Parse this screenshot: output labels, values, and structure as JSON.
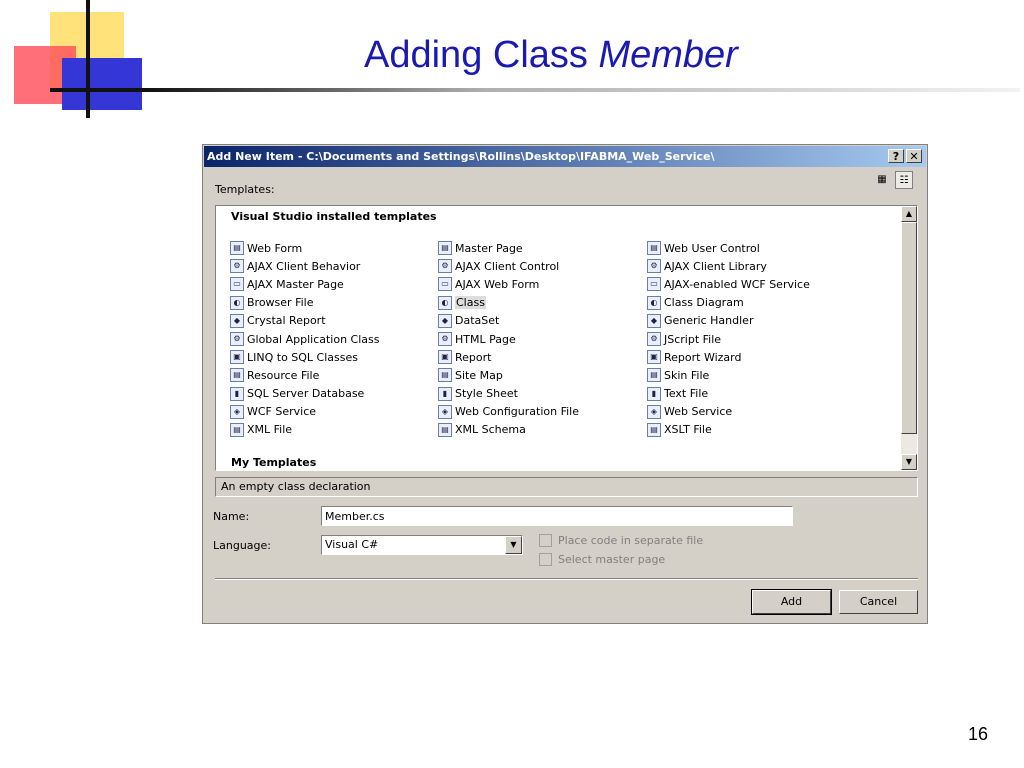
{
  "slide": {
    "title_plain": "Adding Class ",
    "title_emph": "Member",
    "page_number": "16"
  },
  "dialog": {
    "title": "Add New Item - C:\\Documents and Settings\\Rollins\\Desktop\\IFABMA_Web_Service\\",
    "help_label": "?",
    "close_label": "✕",
    "templates_label": "Templates:",
    "group_installed": "Visual Studio installed templates",
    "group_my": "My Templates",
    "columns": [
      [
        {
          "label": "Web Form",
          "icon": "web-form-icon"
        },
        {
          "label": "AJAX Client Behavior",
          "icon": "ajax-client-behavior-icon"
        },
        {
          "label": "AJAX Master Page",
          "icon": "ajax-master-page-icon"
        },
        {
          "label": "Browser File",
          "icon": "browser-file-icon"
        },
        {
          "label": "Crystal Report",
          "icon": "crystal-report-icon"
        },
        {
          "label": "Global Application Class",
          "icon": "global-application-class-icon"
        },
        {
          "label": "LINQ to SQL Classes",
          "icon": "linq-to-sql-icon"
        },
        {
          "label": "Resource File",
          "icon": "resource-file-icon"
        },
        {
          "label": "SQL Server Database",
          "icon": "sql-database-icon"
        },
        {
          "label": "WCF Service",
          "icon": "wcf-service-icon"
        },
        {
          "label": "XML File",
          "icon": "xml-file-icon"
        }
      ],
      [
        {
          "label": "Master Page",
          "icon": "master-page-icon"
        },
        {
          "label": "AJAX Client Control",
          "icon": "ajax-client-control-icon"
        },
        {
          "label": "AJAX Web Form",
          "icon": "ajax-web-form-icon"
        },
        {
          "label": "Class",
          "icon": "class-icon",
          "selected": true
        },
        {
          "label": "DataSet",
          "icon": "dataset-icon"
        },
        {
          "label": "HTML Page",
          "icon": "html-page-icon"
        },
        {
          "label": "Report",
          "icon": "report-icon"
        },
        {
          "label": "Site Map",
          "icon": "site-map-icon"
        },
        {
          "label": "Style Sheet",
          "icon": "style-sheet-icon"
        },
        {
          "label": "Web Configuration File",
          "icon": "web-config-icon"
        },
        {
          "label": "XML Schema",
          "icon": "xml-schema-icon"
        }
      ],
      [
        {
          "label": "Web User Control",
          "icon": "web-user-control-icon"
        },
        {
          "label": "AJAX Client Library",
          "icon": "ajax-client-library-icon"
        },
        {
          "label": "AJAX-enabled WCF Service",
          "icon": "ajax-wcf-service-icon"
        },
        {
          "label": "Class Diagram",
          "icon": "class-diagram-icon"
        },
        {
          "label": "Generic Handler",
          "icon": "generic-handler-icon"
        },
        {
          "label": "JScript File",
          "icon": "jscript-file-icon"
        },
        {
          "label": "Report Wizard",
          "icon": "report-wizard-icon"
        },
        {
          "label": "Skin File",
          "icon": "skin-file-icon"
        },
        {
          "label": "Text File",
          "icon": "text-file-icon"
        },
        {
          "label": "Web Service",
          "icon": "web-service-icon"
        },
        {
          "label": "XSLT File",
          "icon": "xslt-file-icon"
        }
      ]
    ],
    "description": "An empty class declaration",
    "name_label": "Name:",
    "name_value": "Member.cs",
    "language_label": "Language:",
    "language_value": "Visual C#",
    "option_separate_file": "Place code in separate file",
    "option_master_page": "Select master page",
    "add_label": "Add",
    "cancel_label": "Cancel"
  }
}
